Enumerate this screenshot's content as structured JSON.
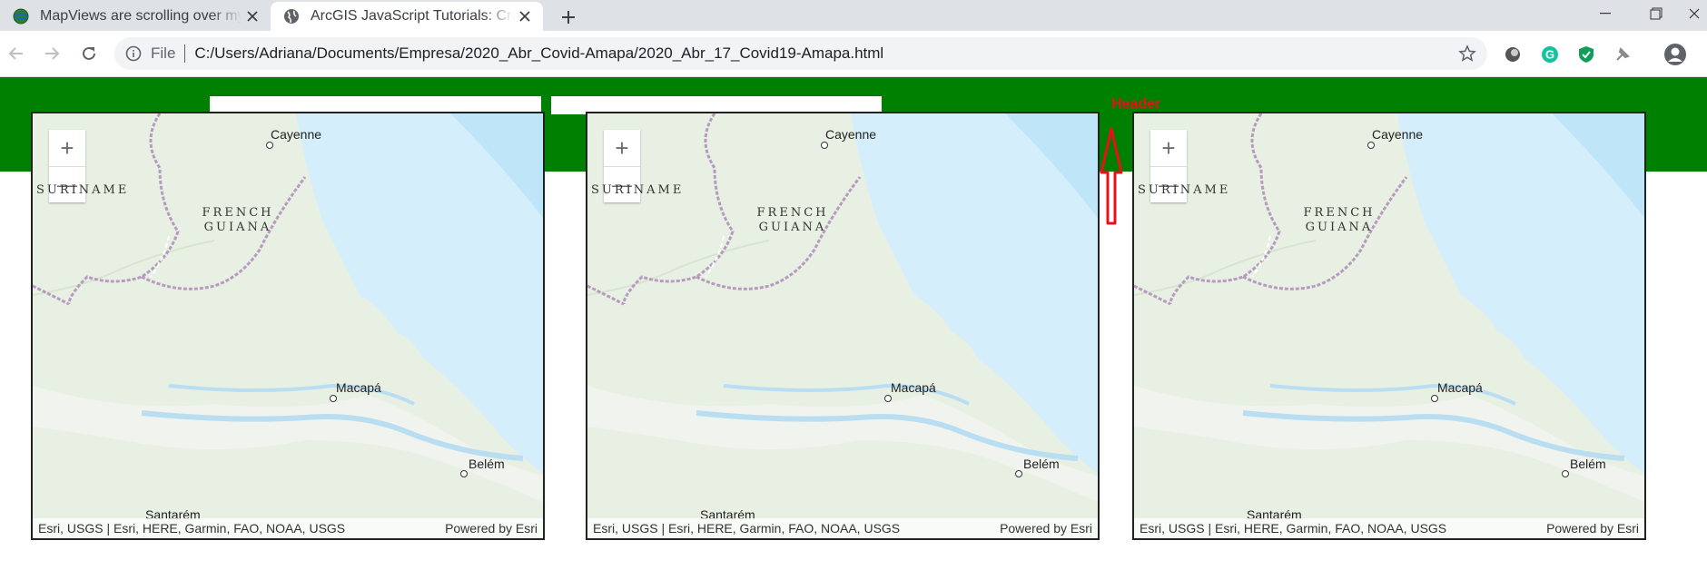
{
  "browser": {
    "tabs": [
      {
        "title": "MapViews are scrolling over my f",
        "favicon": "arcgis-globe-icon"
      },
      {
        "title": "ArcGIS JavaScript Tutorials: Create",
        "favicon": "globe-icon"
      }
    ],
    "address": {
      "scheme_label": "File",
      "url": "C:/Users/Adriana/Documents/Empresa/2020_Abr_Covid-Amapa/2020_Abr_17_Covid19-Amapa.html"
    }
  },
  "annotation": {
    "label": "Header",
    "color": "#e8101a"
  },
  "colors": {
    "header_band": "#008000",
    "annotation": "#e8101a"
  },
  "maps": [
    {
      "zoom_in": "+",
      "zoom_out": "—",
      "labels": {
        "cayenne": "Cayenne",
        "suriname": "SURINAME",
        "french_guiana_1": "FRENCH",
        "french_guiana_2": "GUIANA",
        "macapa": "Macapá",
        "belem": "Belém",
        "santarem": "Santarém"
      },
      "attribution": "Esri, USGS | Esri, HERE, Garmin, FAO, NOAA, USGS",
      "powered_by": "Powered by Esri"
    },
    {
      "zoom_in": "+",
      "zoom_out": "—",
      "labels": {
        "cayenne": "Cayenne",
        "suriname": "SURINAME",
        "french_guiana_1": "FRENCH",
        "french_guiana_2": "GUIANA",
        "macapa": "Macapá",
        "belem": "Belém",
        "santarem": "Santarém"
      },
      "attribution": "Esri, USGS | Esri, HERE, Garmin, FAO, NOAA, USGS",
      "powered_by": "Powered by Esri"
    },
    {
      "zoom_in": "+",
      "zoom_out": "—",
      "labels": {
        "cayenne": "Cayenne",
        "suriname": "SURINAME",
        "french_guiana_1": "FRENCH",
        "french_guiana_2": "GUIANA",
        "macapa": "Macapá",
        "belem": "Belém",
        "santarem": "Santarém"
      },
      "attribution": "Esri, USGS | Esri, HERE, Garmin, FAO, NOAA, USGS",
      "powered_by": "Powered by Esri"
    }
  ]
}
